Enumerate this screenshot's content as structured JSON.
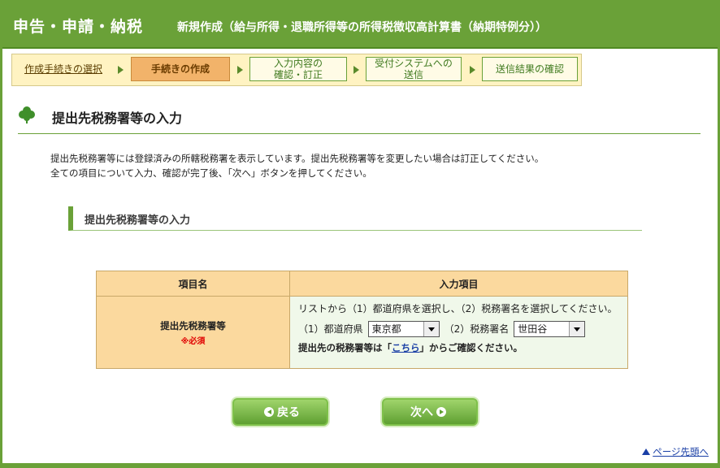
{
  "header": {
    "app_title": "申告・申請・納税",
    "form_title": "新規作成（給与所得・退職所得等の所得税徴収高計算書（納期特例分））"
  },
  "steps": [
    {
      "label": "作成手続きの選択",
      "state": "link"
    },
    {
      "label": "手続きの作成",
      "state": "current"
    },
    {
      "label": "入力内容の\n確認・訂正",
      "state": "upcoming"
    },
    {
      "label": "受付システムへの\n送信",
      "state": "upcoming"
    },
    {
      "label": "送信結果の確認",
      "state": "upcoming"
    }
  ],
  "section": {
    "title": "提出先税務署等の入力",
    "icon": "clover-icon"
  },
  "description": {
    "line1": "提出先税務署等には登録済みの所轄税務署を表示しています。提出先税務署等を変更したい場合は訂正してください。",
    "line2": "全ての項目について入力、確認が完了後、「次へ」ボタンを押してください。"
  },
  "subsection": {
    "title": "提出先税務署等の入力"
  },
  "table": {
    "header_item": "項目名",
    "header_input": "入力項目",
    "row_label": "提出先税務署等",
    "required": "※必須",
    "instruction": "リストから（1）都道府県を選択し、（2）税務署名を選択してください。",
    "pref_label": "（1）都道府県",
    "pref_value": "東京都",
    "office_label": "（2）税務署名",
    "office_value": "世田谷",
    "note_prefix": "提出先の税務署等は「",
    "note_link": "こちら",
    "note_suffix": "」からご確認ください。"
  },
  "buttons": {
    "back": "戻る",
    "next": "次へ"
  },
  "page_top": "ページ先頭へ",
  "colors": {
    "header": "#6aa138",
    "current_step": "#f2b36a",
    "table_header": "#fbd99e"
  }
}
